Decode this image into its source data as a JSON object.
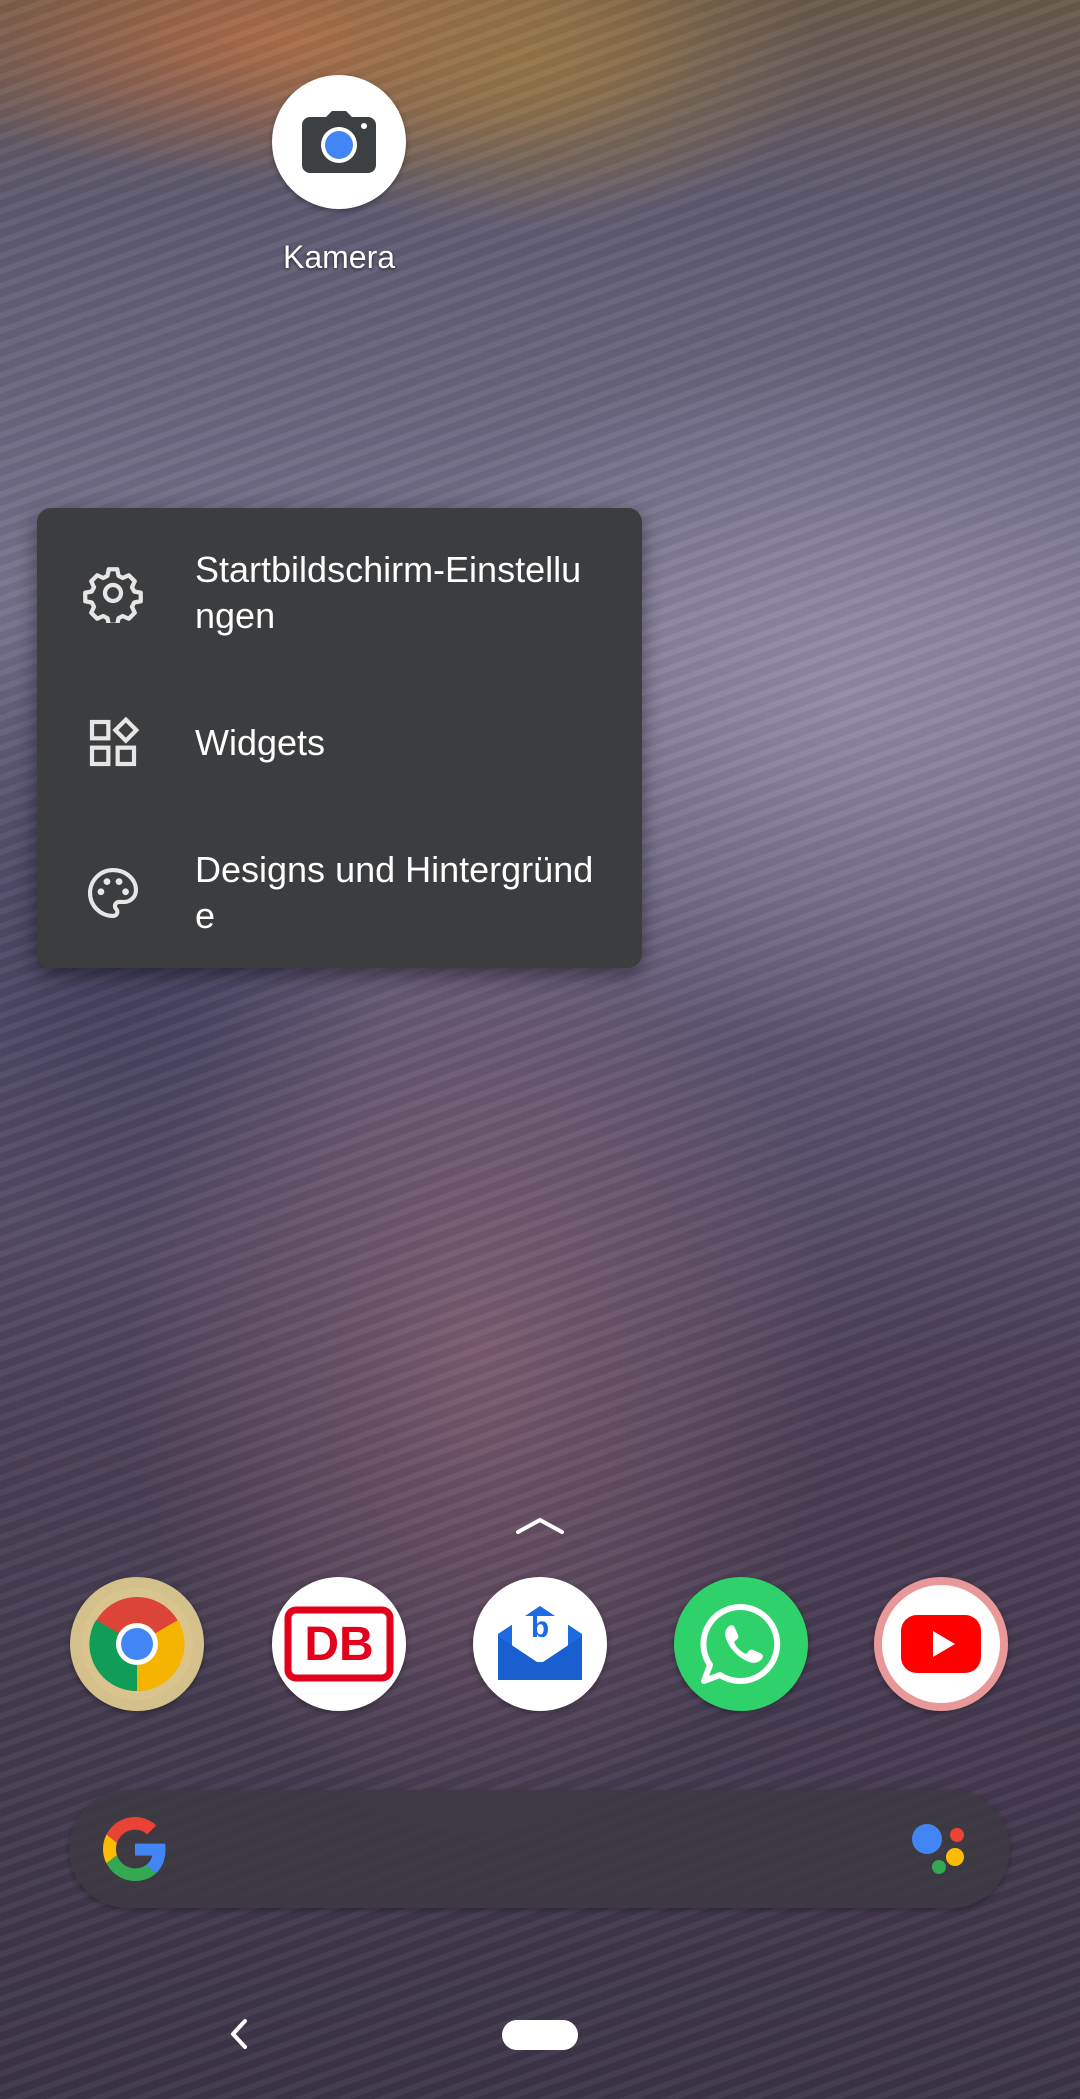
{
  "home": {
    "shortcut": {
      "label": "Kamera",
      "icon": "camera-icon"
    }
  },
  "popup_menu": {
    "items": [
      {
        "label": "Startbildschirm-Einstellungen",
        "icon": "gear-icon"
      },
      {
        "label": "Widgets",
        "icon": "widgets-icon"
      },
      {
        "label": "Designs und Hintergründe",
        "icon": "palette-icon"
      }
    ]
  },
  "dock": {
    "apps": [
      {
        "name": "Chrome",
        "icon": "chrome-icon"
      },
      {
        "name": "DB Navigator",
        "icon": "db-icon",
        "badge_text": "DB"
      },
      {
        "name": "BlueMail",
        "icon": "bluemail-icon",
        "badge_text": "b"
      },
      {
        "name": "WhatsApp",
        "icon": "whatsapp-icon"
      },
      {
        "name": "YouTube",
        "icon": "youtube-icon"
      }
    ]
  },
  "search_bar": {
    "logo": "google-g-icon",
    "assistant": "google-assistant-icon"
  },
  "colors": {
    "menu_bg": "#3c3d3f",
    "whatsapp": "#2fd16b",
    "db_red": "#e3001b",
    "youtube_red": "#ff0000",
    "bluemail_blue": "#1c6be0"
  }
}
